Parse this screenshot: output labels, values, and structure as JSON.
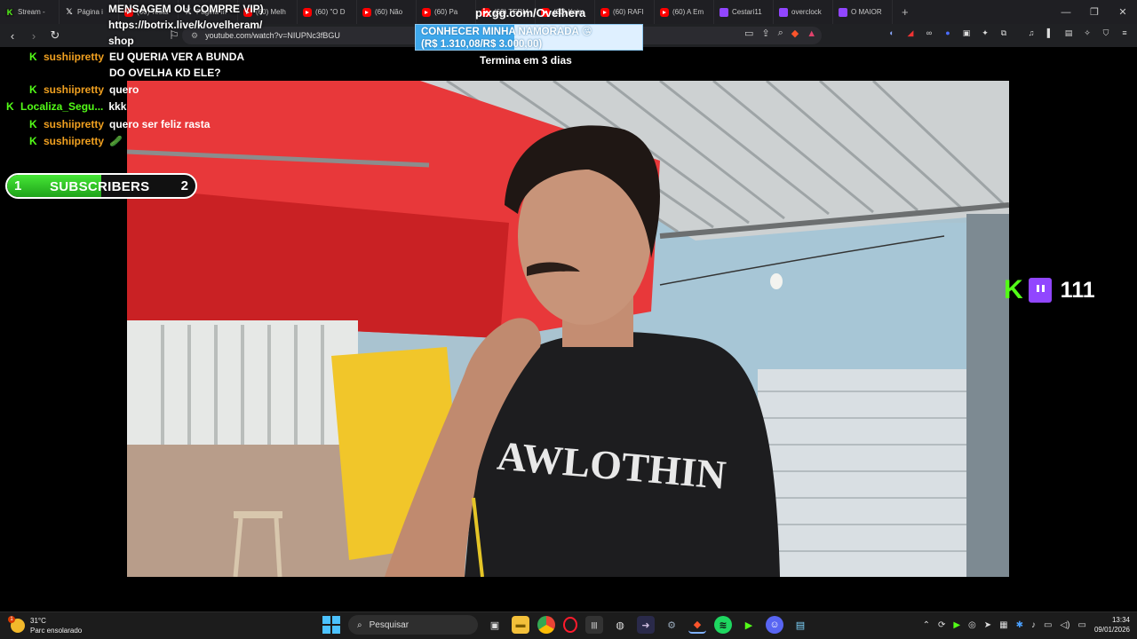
{
  "browser": {
    "tabs": [
      {
        "label": "Stream - ",
        "icon": "kick"
      },
      {
        "label": "Página i",
        "icon": "x"
      },
      {
        "label": "(60) Testa",
        "icon": "yt"
      },
      {
        "label": "Página In",
        "icon": "x"
      },
      {
        "label": "(60) Melh",
        "icon": "yt"
      },
      {
        "label": "(60) \"O D",
        "icon": "yt"
      },
      {
        "label": "(60) Não",
        "icon": "yt"
      },
      {
        "label": "(60) Pa",
        "icon": "yt"
      },
      {
        "label": "(60) TERM",
        "icon": "yt"
      },
      {
        "label": "(60) Keim",
        "icon": "yt"
      },
      {
        "label": "(60) RAFI",
        "icon": "yt"
      },
      {
        "label": "(60) A Em",
        "icon": "yt"
      },
      {
        "label": "Cestari11",
        "icon": "tw"
      },
      {
        "label": "overclock",
        "icon": "tw"
      },
      {
        "label": "O MAIOR",
        "icon": "tw"
      }
    ],
    "new_tab": "+",
    "url": "youtube.com/watch?v=NIUPNc3fBGU",
    "window_controls": {
      "minimize": "—",
      "restore": "❐",
      "close": "✕"
    }
  },
  "overlay": {
    "chat_top_lines": [
      "MENSAGEM OU COMPRE VIP)",
      "https://botrix.live/k/ovelheram/",
      "shop"
    ],
    "chat": [
      {
        "user": "sushiipretty",
        "user_color": "#f0a020",
        "message": "EU QUERIA VER A BUNDA DO OVELHA KD ELE?"
      },
      {
        "user": "sushiipretty",
        "user_color": "#f0a020",
        "message": "quero"
      },
      {
        "user": "Localiza_Segu...",
        "user_color": "#53fc18",
        "message": "kkk"
      },
      {
        "user": "sushiipretty",
        "user_color": "#f0a020",
        "message": "quero ser feliz rasta"
      },
      {
        "user": "sushiipretty",
        "user_color": "#f0a020",
        "message": "🥒"
      }
    ],
    "subs": {
      "current": "1",
      "label": "SUBSCRIBERS",
      "goal": "2",
      "progress": 0.5
    },
    "pix_title": "pixgg.com/Ovelhera",
    "goal_line1": "CONHECER MINHA NAMORADA 😘",
    "goal_line2": "(R$ 1.310,08/R$ 3.000,00)",
    "goal_progress": 0.4367,
    "goal_ends": "Termina em 3 dias",
    "viewers": "111",
    "shirt_text": "AWLOTHIN"
  },
  "taskbar": {
    "weather_temp": "31°C",
    "weather_desc": "Parc ensolarado",
    "weather_badge": "1",
    "search_placeholder": "Pesquisar",
    "time": "13:34",
    "date": "09/01/2026"
  }
}
